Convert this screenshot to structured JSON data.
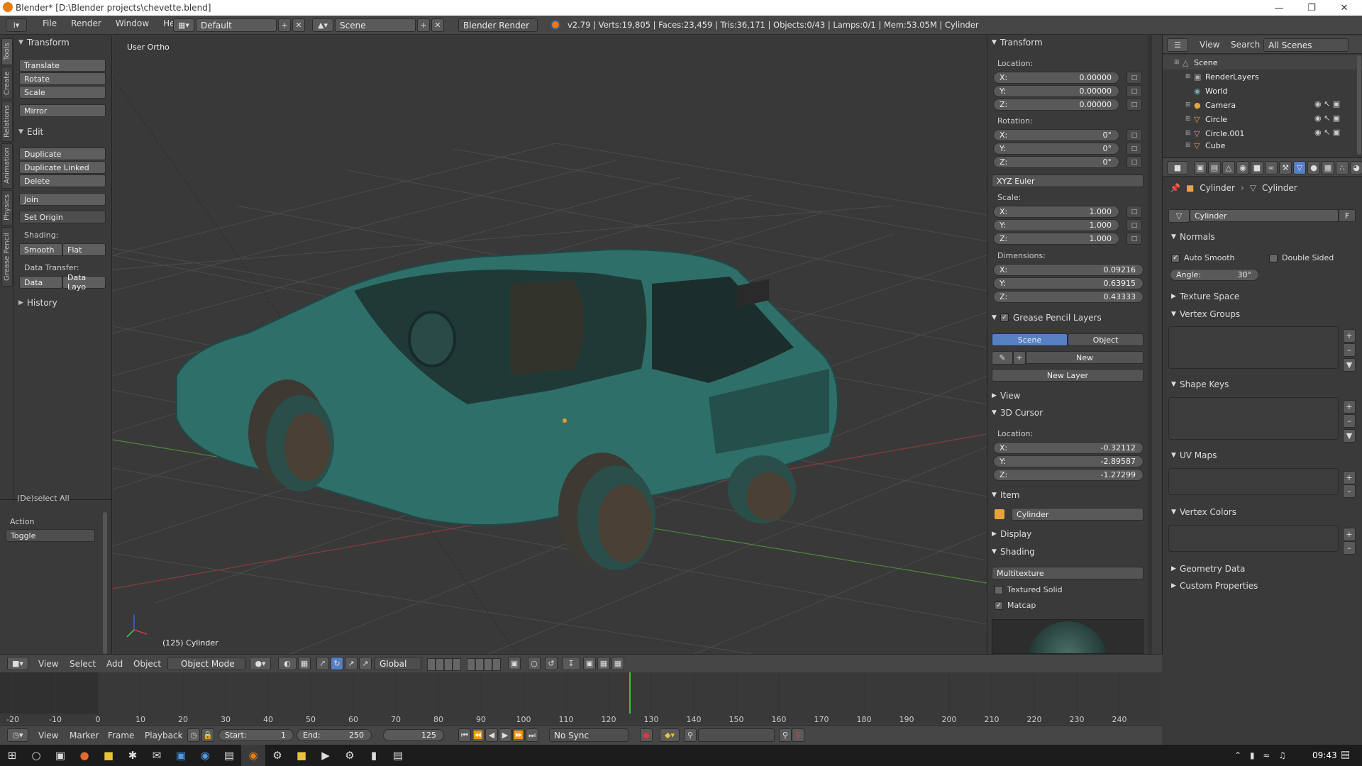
{
  "window": {
    "title": "Blender* [D:\\Blender projects\\chevette.blend]"
  },
  "mainbar": {
    "menus": [
      "File",
      "Render",
      "Window",
      "Help"
    ],
    "screen_layout": "Default",
    "scene": "Scene",
    "engine": "Blender Render",
    "stats": "v2.79 | Verts:19,805 | Faces:23,459 | Tris:36,171 | Objects:0/43 | Lamps:0/1 | Mem:53.05M | Cylinder"
  },
  "toolstrip": {
    "tabs": [
      "Tools",
      "Create",
      "Relations",
      "Animation",
      "Physics",
      "Grease Pencil"
    ]
  },
  "toolshelf": {
    "transform_header": "Transform",
    "translate": "Translate",
    "rotate": "Rotate",
    "scale": "Scale",
    "mirror": "Mirror",
    "edit_header": "Edit",
    "duplicate": "Duplicate",
    "duplicate_linked": "Duplicate Linked",
    "delete": "Delete",
    "join": "Join",
    "set_origin": "Set Origin",
    "shading_label": "Shading:",
    "smooth": "Smooth",
    "flat": "Flat",
    "data_transfer_label": "Data Transfer:",
    "data": "Data",
    "data_layo": "Data Layo",
    "history_header": "History",
    "op_title": "(De)select All",
    "action_label": "Action",
    "action_value": "Toggle"
  },
  "viewport": {
    "view_label": "User Ortho",
    "object_label": "(125) Cylinder"
  },
  "npanel": {
    "transform_header": "Transform",
    "location_label": "Location:",
    "location": {
      "x": "0.00000",
      "y": "0.00000",
      "z": "0.00000"
    },
    "rotation_label": "Rotation:",
    "rotation": {
      "x": "0°",
      "y": "0°",
      "z": "0°"
    },
    "rotation_mode": "XYZ Euler",
    "scale_label": "Scale:",
    "scale": {
      "x": "1.000",
      "y": "1.000",
      "z": "1.000"
    },
    "dimensions_label": "Dimensions:",
    "dimensions": {
      "x": "0.09216",
      "y": "0.63915",
      "z": "0.43333"
    },
    "axis": {
      "x": "X:",
      "y": "Y:",
      "z": "Z:"
    },
    "grease_header": "Grease Pencil Layers",
    "scene_tab": "Scene",
    "object_tab": "Object",
    "new_btn": "New",
    "new_layer_btn": "New Layer",
    "view_header": "View",
    "cursor_header": "3D Cursor",
    "cursor_location_label": "Location:",
    "cursor": {
      "x": "-0.32112",
      "y": "-2.89587",
      "z": "-1.27299"
    },
    "item_header": "Item",
    "item_name": "Cylinder",
    "display_header": "Display",
    "shading_header": "Shading",
    "shading_mode": "Multitexture",
    "textured_solid": "Textured Solid",
    "matcap": "Matcap"
  },
  "outliner": {
    "view_menu": "View",
    "search_menu": "Search",
    "scenes_select": "All Scenes",
    "rows": [
      "Scene",
      "RenderLayers",
      "World",
      "Camera",
      "Circle",
      "Circle.001",
      "Cube"
    ]
  },
  "properties": {
    "breadcrumb_object": "Cylinder",
    "breadcrumb_mesh": "Cylinder",
    "mesh_name": "Cylinder",
    "fake_user": "F",
    "normals_header": "Normals",
    "auto_smooth": "Auto Smooth",
    "double_sided": "Double Sided",
    "angle_label": "Angle:",
    "angle_value": "30°",
    "texture_space": "Texture Space",
    "vertex_groups": "Vertex Groups",
    "shape_keys": "Shape Keys",
    "uv_maps": "UV Maps",
    "vertex_colors": "Vertex Colors",
    "geometry_data": "Geometry Data",
    "custom_properties": "Custom Properties"
  },
  "vp_header": {
    "menus": [
      "View",
      "Select",
      "Add",
      "Object"
    ],
    "mode": "Object Mode",
    "orientation": "Global"
  },
  "timeline": {
    "ticks": [
      "-20",
      "-10",
      "0",
      "10",
      "20",
      "30",
      "40",
      "50",
      "60",
      "70",
      "80",
      "90",
      "100",
      "110",
      "120",
      "130",
      "140",
      "150",
      "160",
      "170",
      "180",
      "190",
      "200",
      "210",
      "220",
      "230",
      "240"
    ],
    "current_frame_value": 125
  },
  "tl_header": {
    "menus": [
      "View",
      "Marker",
      "Frame",
      "Playback"
    ],
    "start": "Start:",
    "start_val": "1",
    "end": "End:",
    "end_val": "250",
    "current": "125",
    "sync": "No Sync"
  },
  "taskbar": {
    "clock": "09:43"
  },
  "colors": {
    "accent": "#5680c2",
    "car": "#2f6f6a",
    "grid_x": "#8a3b3b",
    "grid_y": "#4c8a3b",
    "timeline_cursor": "#3fc23f"
  }
}
